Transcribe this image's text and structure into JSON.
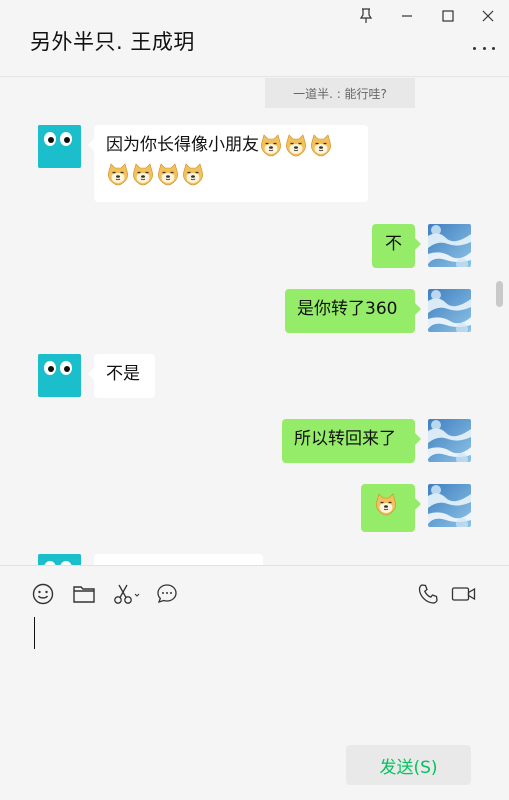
{
  "header": {
    "title": "另外半只. 王成玥",
    "controls": [
      "pin-icon",
      "minimize-icon",
      "maximize-icon",
      "close-icon"
    ],
    "more_icon": "more-icon"
  },
  "chat": {
    "system_message": "一道半. : 能行哇?",
    "messages": [
      {
        "side": "left",
        "text": "因为你长得像小朋友",
        "emoji_after_text": 3,
        "emoji_second_line": 4
      },
      {
        "side": "right",
        "text": "不"
      },
      {
        "side": "right",
        "text": "是你转了360"
      },
      {
        "side": "left",
        "text": "不是"
      },
      {
        "side": "right",
        "text": "所以转回来了"
      },
      {
        "side": "right",
        "text": "",
        "emoji_only": 1
      }
    ]
  },
  "toolbar": {
    "left": [
      "emoji-icon",
      "folder-icon",
      "scissors-icon",
      "chat-bubble-icon"
    ],
    "right": [
      "phone-icon",
      "video-icon"
    ]
  },
  "composer": {
    "value": "",
    "send_label": "发送(S)"
  },
  "colors": {
    "bubble_out": "#95ec69",
    "bubble_in": "#ffffff",
    "send_text": "#07c160",
    "avatar_teal": "#1bbfcb"
  }
}
